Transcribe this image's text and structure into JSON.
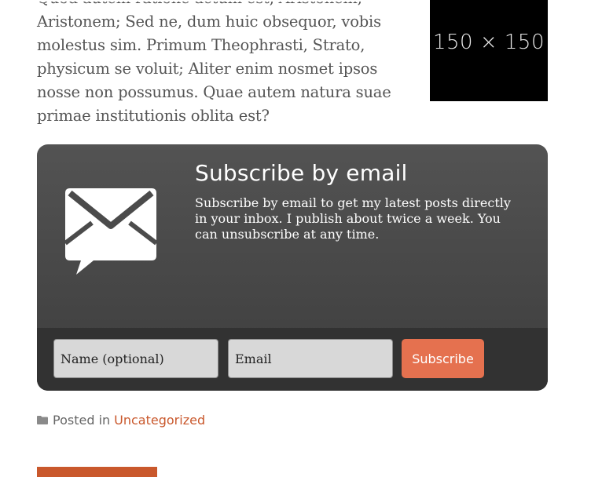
{
  "article": {
    "line1": "Quod autem ratione actum est, Aristonem;",
    "text": "Aristonem; Sed ne, dum huic obsequor, vobis molestus sim. Primum Theophrasti, Strato, physicum se voluit; Aliter enim nosmet ipsos nosse non possumus. Quae autem natura suae primae institutionis oblita est?"
  },
  "placeholder_image": {
    "label": "150 × 150"
  },
  "subscribe": {
    "title": "Subscribe by email",
    "description": "Subscribe by email to get my latest posts directly in your inbox. I publish about twice a week. You can unsubscribe at any time.",
    "name_placeholder": "Name (optional)",
    "email_placeholder": "Email",
    "button_label": "Subscribe",
    "icon": "envelope-chat-icon",
    "button_color": "#e5714f"
  },
  "post_meta": {
    "posted_in_label": "Posted in",
    "category": "Uncategorized",
    "icon": "folder-icon",
    "link_color": "#c9582c"
  }
}
